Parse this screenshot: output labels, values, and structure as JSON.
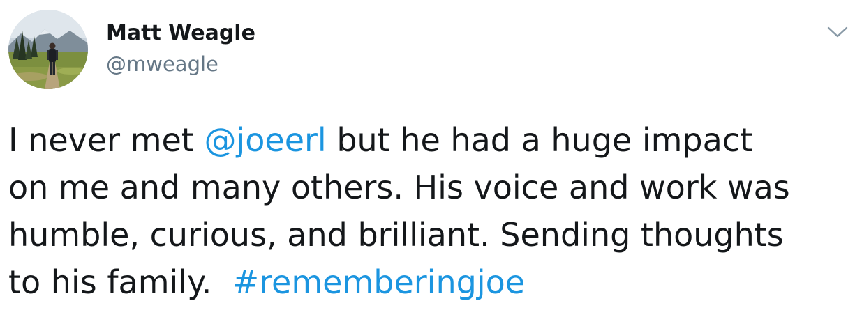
{
  "author": {
    "display_name": "Matt Weagle",
    "handle": "@mweagle",
    "avatar_icon": "profile-photo-hiker"
  },
  "menu_icon": "chevron-down-icon",
  "tweet": {
    "line1": {
      "before": "I never met ",
      "mention": "@joeerl",
      "after": " but he had a huge impact"
    },
    "line2": "on me and many others. His voice and work was",
    "line3": "humble, curious, and brilliant. Sending thoughts",
    "line4": {
      "before": "to his family.  ",
      "hashtag": "#rememberingjoe"
    }
  },
  "colors": {
    "text": "#14171a",
    "secondary": "#657786",
    "link": "#1b95e0",
    "background": "#ffffff"
  }
}
